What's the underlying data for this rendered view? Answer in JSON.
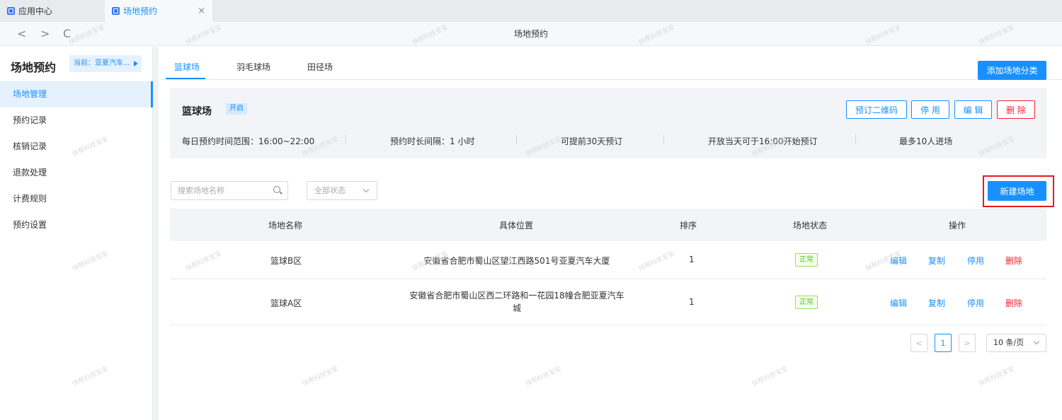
{
  "tabs": [
    {
      "label": "应用中心"
    },
    {
      "label": "场地预约",
      "close": "×"
    }
  ],
  "address": {
    "title": "场地预约",
    "back": "<",
    "forward": ">",
    "reload": "C"
  },
  "sidebar": {
    "title": "场地预约",
    "current": "当前：亚夏汽车...",
    "items": [
      {
        "label": "场地管理",
        "active": true
      },
      {
        "label": "预约记录"
      },
      {
        "label": "核销记录"
      },
      {
        "label": "退款处理"
      },
      {
        "label": "计费规则"
      },
      {
        "label": "预约设置"
      }
    ]
  },
  "category_tabs": [
    "篮球场",
    "羽毛球场",
    "田径场"
  ],
  "add_category_button": "添加场地分类",
  "venue": {
    "name": "篮球场",
    "status": "开启",
    "buttons": {
      "qrcode": "预订二维码",
      "disable": "停 用",
      "edit": "编 辑",
      "delete": "删 除"
    },
    "info": [
      "每日预约时间范围：16:00~22:00",
      "预约时长间隔：1 小时",
      "可提前30天预订",
      "开放当天可于16:00开始预订",
      "最多10人进场"
    ]
  },
  "filters": {
    "search_placeholder": "搜索场地名称",
    "status_placeholder": "全部状态"
  },
  "new_venue_button": "新建场地",
  "table": {
    "headers": [
      "场地名称",
      "具体位置",
      "排序",
      "场地状态",
      "操作"
    ],
    "rows": [
      {
        "name": "篮球B区",
        "location_line1": "安徽省合肥市蜀山区望江西路501号亚夏汽车大厦",
        "location_line2": "",
        "order": "1",
        "status": "正常"
      },
      {
        "name": "篮球A区",
        "location_line1": "安徽省合肥市蜀山区西二环路和一花园18幢合肥亚夏汽车",
        "location_line2": "城",
        "order": "1",
        "status": "正常"
      }
    ],
    "actions": {
      "edit": "编辑",
      "copy": "复制",
      "disable": "停用",
      "delete": "删除"
    }
  },
  "pagination": {
    "prev": "<",
    "page": "1",
    "next": ">",
    "page_size": "10 条/页"
  },
  "watermark": "快帮科技宝宝",
  "colors": {
    "primary": "#1890ff",
    "danger": "#f5222d",
    "success": "#52c41a",
    "highlight": "#e31b1b"
  }
}
